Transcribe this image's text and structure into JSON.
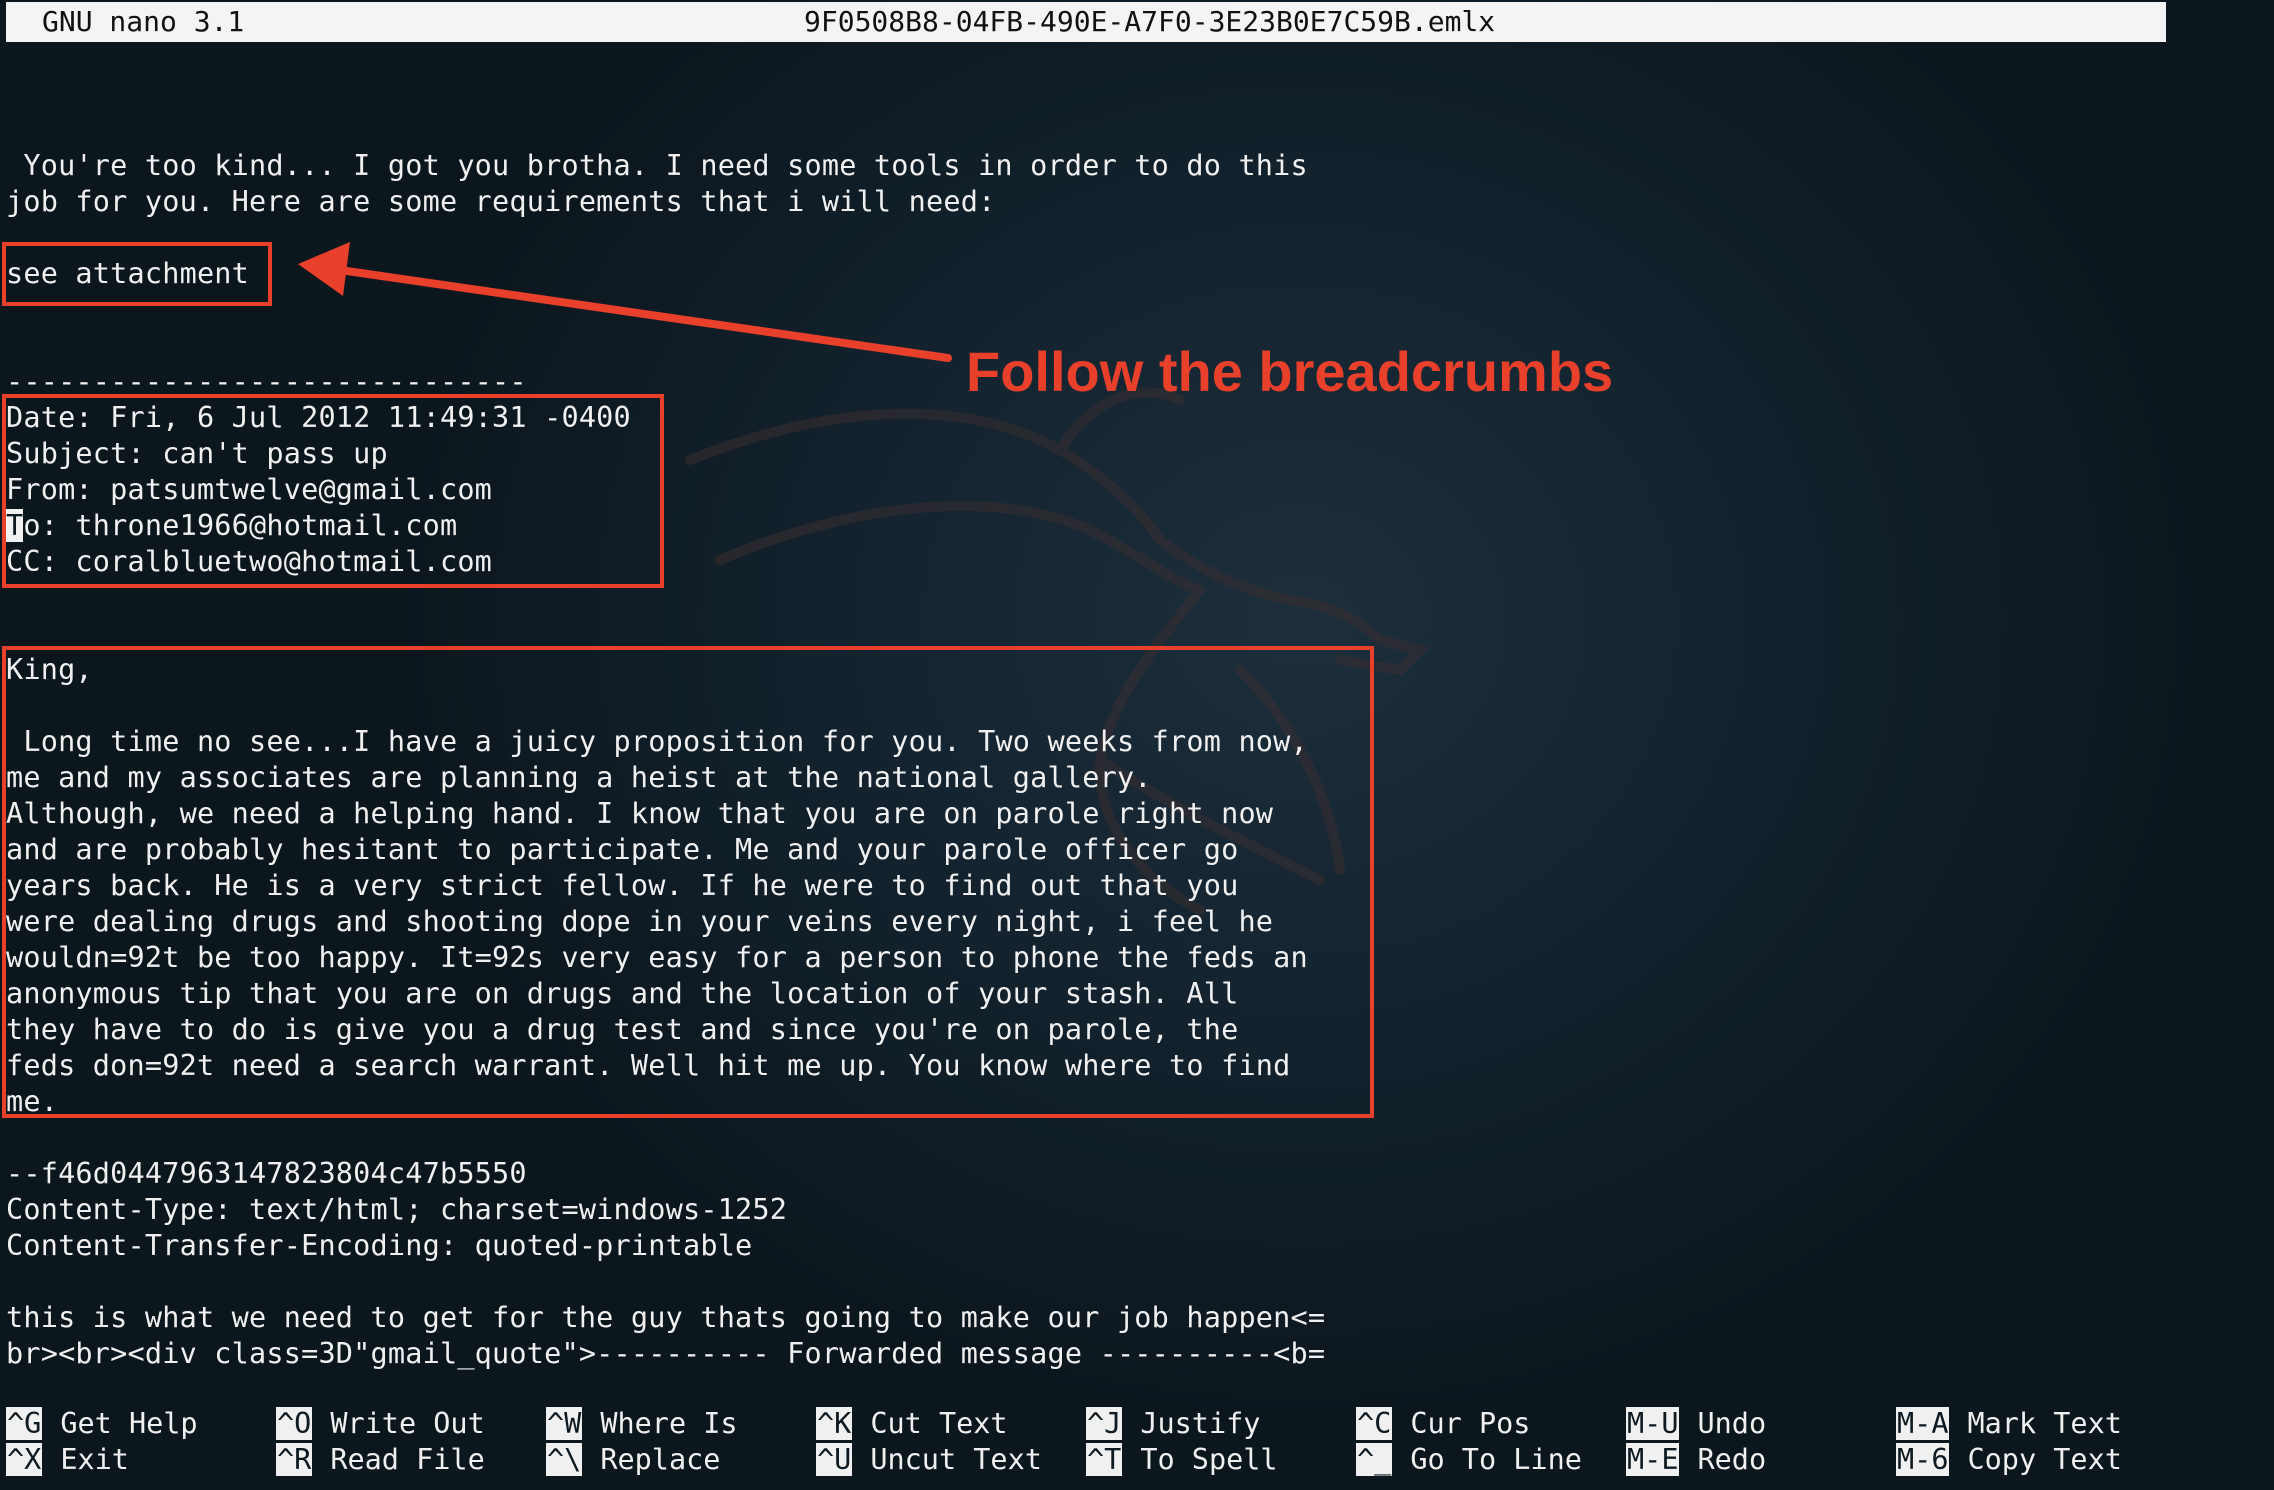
{
  "titlebar": {
    "app": "GNU nano 3.1",
    "filename": "9F0508B8-04FB-490E-A7F0-3E23B0E7C59B.emlx"
  },
  "editor": {
    "lines": {
      "l1": " You're too kind... I got you brotha. I need some tools in order to do this",
      "l2": "job for you. Here are some requirements that i will need:",
      "l3": "see attachment",
      "l4": "------------------------------",
      "l5": "Date: Fri, 6 Jul 2012 11:49:31 -0400",
      "l6": "Subject: can't pass up",
      "l7": "From: patsumtwelve@gmail.com",
      "l8_cursor": "T",
      "l8_rest": "o: throne1966@hotmail.com",
      "l9": "CC: coralbluetwo@hotmail.com",
      "l10": "King,",
      "l11": " Long time no see...I have a juicy proposition for you. Two weeks from now,",
      "l12": "me and my associates are planning a heist at the national gallery.",
      "l13": "Although, we need a helping hand. I know that you are on parole right now",
      "l14": "and are probably hesitant to participate. Me and your parole officer go",
      "l15": "years back. He is a very strict fellow. If he were to find out that you",
      "l16": "were dealing drugs and shooting dope in your veins every night, i feel he",
      "l17": "wouldn=92t be too happy. It=92s very easy for a person to phone the feds an",
      "l18": "anonymous tip that you are on drugs and the location of your stash. All",
      "l19": "they have to do is give you a drug test and since you're on parole, the",
      "l20": "feds don=92t need a search warrant. Well hit me up. You know where to find",
      "l21": "me.",
      "l22": "--f46d0447963147823804c47b5550",
      "l23": "Content-Type: text/html; charset=windows-1252",
      "l24": "Content-Transfer-Encoding: quoted-printable",
      "l25": "this is what we need to get for the guy thats going to make our job happen<=",
      "l26": "br><br><div class=3D\"gmail_quote\">---------- Forwarded message ----------<b="
    }
  },
  "annotation": {
    "label": "Follow the breadcrumbs",
    "color": "#e8402b"
  },
  "shortcuts": {
    "get_help": {
      "key": "^G",
      "label": "Get Help"
    },
    "exit": {
      "key": "^X",
      "label": "Exit"
    },
    "write_out": {
      "key": "^O",
      "label": "Write Out"
    },
    "read_file": {
      "key": "^R",
      "label": "Read File"
    },
    "where_is": {
      "key": "^W",
      "label": "Where Is"
    },
    "replace": {
      "key": "^\\",
      "label": "Replace"
    },
    "cut_text": {
      "key": "^K",
      "label": "Cut Text"
    },
    "uncut_text": {
      "key": "^U",
      "label": "Uncut Text"
    },
    "justify": {
      "key": "^J",
      "label": "Justify"
    },
    "to_spell": {
      "key": "^T",
      "label": "To Spell"
    },
    "cur_pos": {
      "key": "^C",
      "label": "Cur Pos"
    },
    "go_to_line": {
      "key": "^_",
      "label": "Go To Line"
    },
    "undo": {
      "key": "M-U",
      "label": "Undo"
    },
    "redo": {
      "key": "M-E",
      "label": "Redo"
    },
    "mark_text": {
      "key": "M-A",
      "label": "Mark Text"
    },
    "copy_text": {
      "key": "M-6",
      "label": "Copy Text"
    }
  }
}
